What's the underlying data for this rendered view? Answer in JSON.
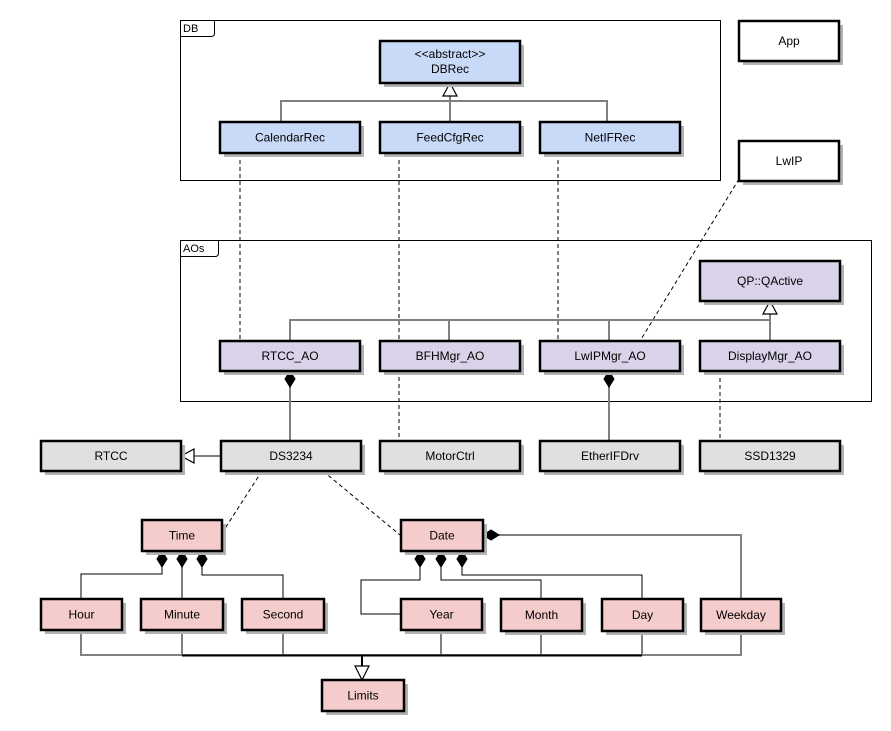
{
  "colors": {
    "db": "#c9daf8",
    "ao": "#d9d2e9",
    "hw": "#e0e0e0",
    "time": "#f4cccc",
    "plain": "#ffffff"
  },
  "packages": {
    "db": {
      "label": "DB"
    },
    "aos": {
      "label": "AOs"
    }
  },
  "classes": {
    "app": {
      "label": "App"
    },
    "lwip": {
      "label": "LwIP"
    },
    "dbrec": {
      "stereotype": "<<abstract>>",
      "label": "DBRec"
    },
    "calendarrec": {
      "label": "CalendarRec"
    },
    "feedcfgrec": {
      "label": "FeedCfgRec"
    },
    "netifrec": {
      "label": "NetIFRec"
    },
    "qactive": {
      "label": "QP::QActive"
    },
    "rtcc_ao": {
      "label": "RTCC_AO"
    },
    "bfhmgr_ao": {
      "label": "BFHMgr_AO"
    },
    "lwipmgr_ao": {
      "label": "LwIPMgr_AO"
    },
    "displaymgr_ao": {
      "label": "DisplayMgr_AO"
    },
    "rtcc": {
      "label": "RTCC"
    },
    "ds3234": {
      "label": "DS3234"
    },
    "motorctrl": {
      "label": "MotorCtrl"
    },
    "etherifdrv": {
      "label": "EtherIFDrv"
    },
    "ssd1329": {
      "label": "SSD1329"
    },
    "time": {
      "label": "Time"
    },
    "date": {
      "label": "Date"
    },
    "hour": {
      "label": "Hour"
    },
    "minute": {
      "label": "Minute"
    },
    "second": {
      "label": "Second"
    },
    "year": {
      "label": "Year"
    },
    "month": {
      "label": "Month"
    },
    "day": {
      "label": "Day"
    },
    "weekday": {
      "label": "Weekday"
    },
    "limits": {
      "label": "Limits"
    }
  }
}
